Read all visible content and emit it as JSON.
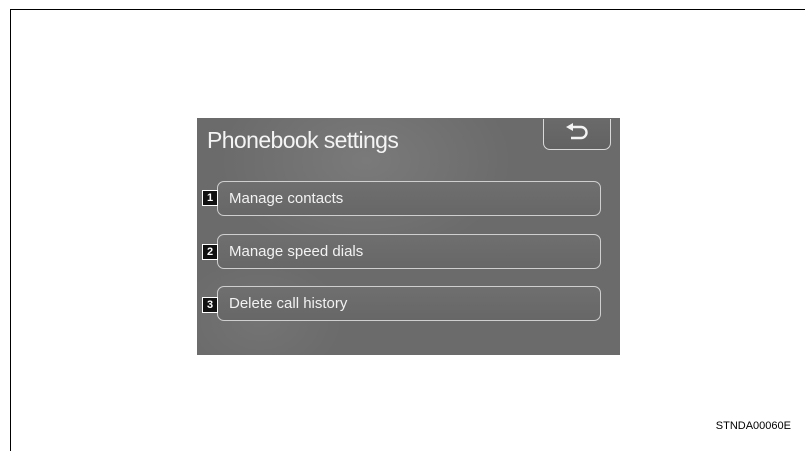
{
  "screen": {
    "title": "Phonebook settings",
    "back_button_icon": "return-arrow-icon",
    "menu_items": [
      {
        "callout": "1",
        "label": "Manage contacts"
      },
      {
        "callout": "2",
        "label": "Manage speed dials"
      },
      {
        "callout": "3",
        "label": "Delete call history"
      }
    ],
    "colors": {
      "screen_background": "#6b6b6b",
      "text": "#f2f2f2",
      "button_border": "#cfcfcf"
    }
  },
  "figure_code": "STNDA00060E"
}
